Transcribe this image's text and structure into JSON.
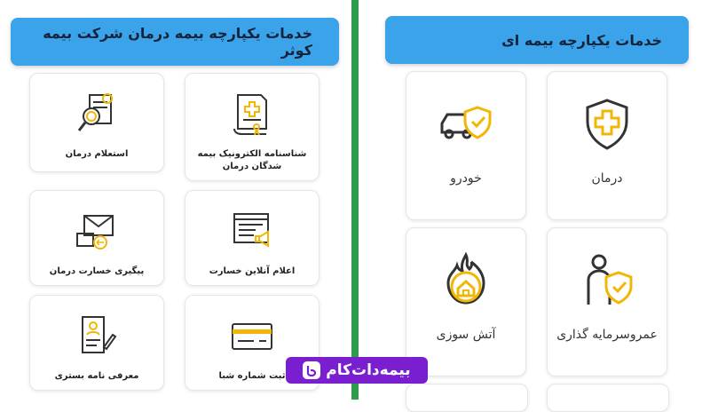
{
  "left_panel": {
    "title": "خدمات یکپارچه بیمه درمان شرکت بیمه کوثر",
    "cards": [
      {
        "label": "شناسنامه الکترونیک بیمه شدگان درمان",
        "icon": "document-medical-icon"
      },
      {
        "label": "استعلام درمان",
        "icon": "search-document-icon"
      },
      {
        "label": "اعلام آنلاین خسارت",
        "icon": "browser-megaphone-icon"
      },
      {
        "label": "پیگیری خسارت درمان",
        "icon": "envelope-message-icon"
      },
      {
        "label": "ثبت شماره شبا",
        "icon": "bank-card-icon"
      },
      {
        "label": "معرفی نامه بستری",
        "icon": "letter-pen-icon"
      }
    ]
  },
  "right_panel": {
    "title": "خدمات یکپارچه بیمه ای",
    "cards": [
      {
        "label": "درمان",
        "icon": "medical-shield-icon"
      },
      {
        "label": "خودرو",
        "icon": "car-shield-icon"
      },
      {
        "label": "عمروسرمایه گذاری",
        "icon": "person-shield-icon"
      },
      {
        "label": "آتش سوزی",
        "icon": "house-fire-icon"
      }
    ]
  },
  "logo": {
    "text": "بیمه‌دات‌کام"
  },
  "colors": {
    "accent": "#3aa3ea",
    "divider": "#2e9c4f",
    "brand": "#7a1fd0",
    "icon_yellow": "#f2b705"
  }
}
